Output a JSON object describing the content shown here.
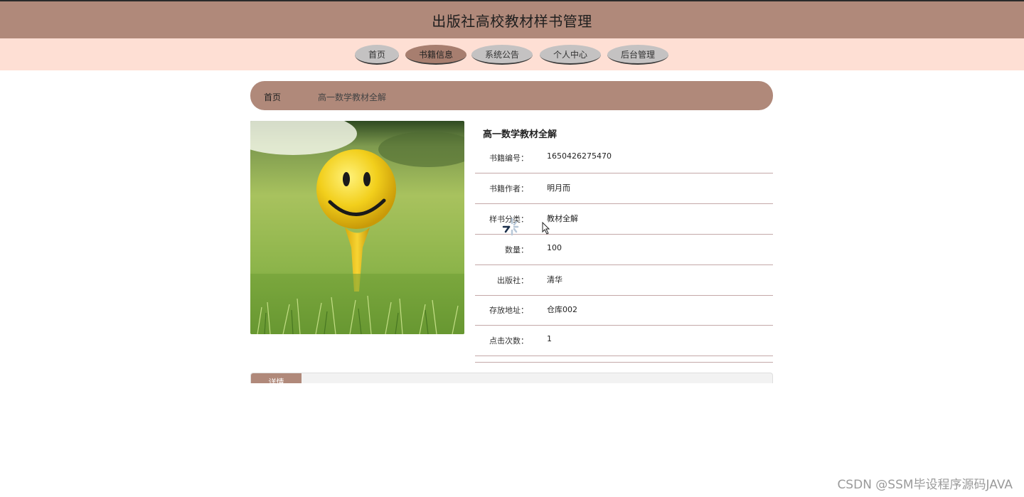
{
  "header": {
    "title": "出版社高校教材样书管理"
  },
  "nav": {
    "items": [
      {
        "label": "首页"
      },
      {
        "label": "书籍信息"
      },
      {
        "label": "系统公告"
      },
      {
        "label": "个人中心"
      },
      {
        "label": "后台管理"
      }
    ],
    "active_index": 1
  },
  "breadcrumb": {
    "home": "首页",
    "current": "高一数学教材全解"
  },
  "book": {
    "image_icon": "smiley-golf-ball-image",
    "title": "高一数学教材全解",
    "fields": [
      {
        "label": "书籍编号：",
        "value": "1650426275470"
      },
      {
        "label": "书籍作者：",
        "value": "明月而"
      },
      {
        "label": "样书分类：",
        "value": "教材全解"
      },
      {
        "label": "数量：",
        "value": "100"
      },
      {
        "label": "出版社：",
        "value": "清华"
      },
      {
        "label": "存放地址：",
        "value": "仓库002"
      },
      {
        "label": "点击次数：",
        "value": "1"
      }
    ]
  },
  "tabs": {
    "detail_label": "详情"
  },
  "watermark": "CSDN @SSM毕设程序源码JAVA",
  "colors": {
    "header_bg": "#b0897a",
    "nav_bg": "#fedfd4",
    "nav_button": "#c4c2c2",
    "nav_button_active": "#a77e6f",
    "row_divider": "#c4a8a8"
  }
}
